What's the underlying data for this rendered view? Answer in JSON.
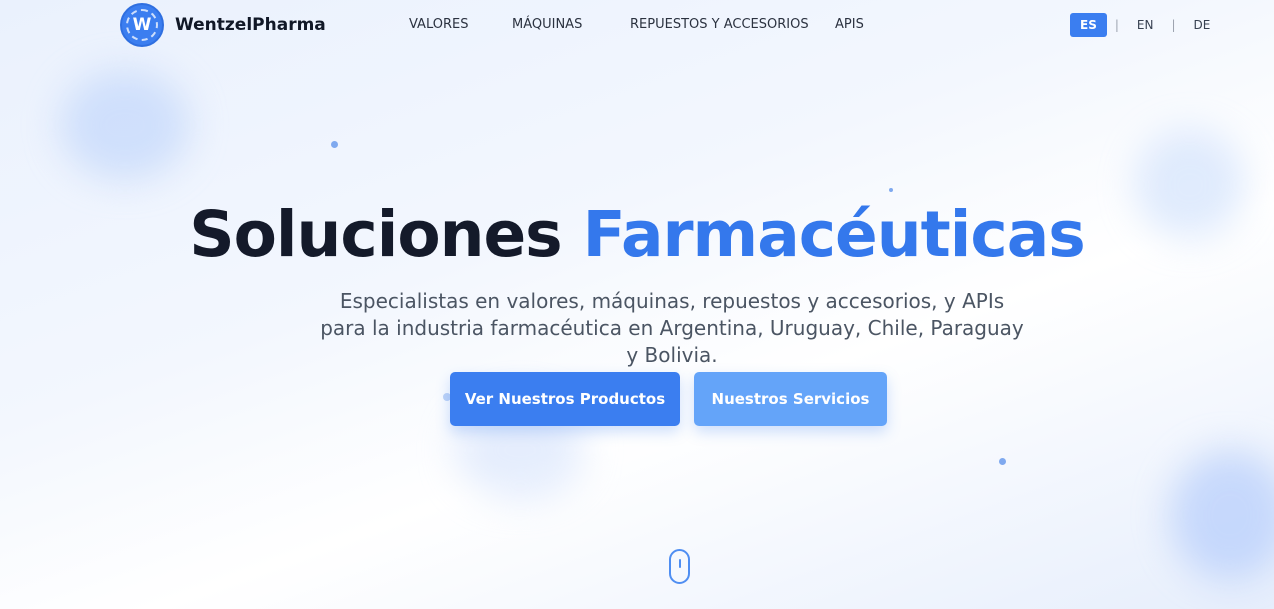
{
  "header": {
    "logo_letter": "W",
    "brand": "WentzelPharma",
    "nav": [
      "VALORES",
      "MÁQUINAS",
      "REPUESTOS Y ACCESORIOS",
      "APIS"
    ],
    "languages": [
      "ES",
      "EN",
      "DE"
    ],
    "active_language": "ES"
  },
  "hero": {
    "title_plain": "Soluciones",
    "title_accent": "Farmacéuticas",
    "subtitle": "Especialistas en valores, máquinas, repuestos y accesorios, y APIs para la industria farmacéutica en Argentina, Uruguay, Chile, Paraguay y Bolivia.",
    "primary_button": "Ver Nuestros Productos",
    "secondary_button": "Nuestros Servicios"
  },
  "colors": {
    "accent": "#3b7ef0",
    "secondary_button": "#64a4f9",
    "title_text": "#141a2a"
  }
}
